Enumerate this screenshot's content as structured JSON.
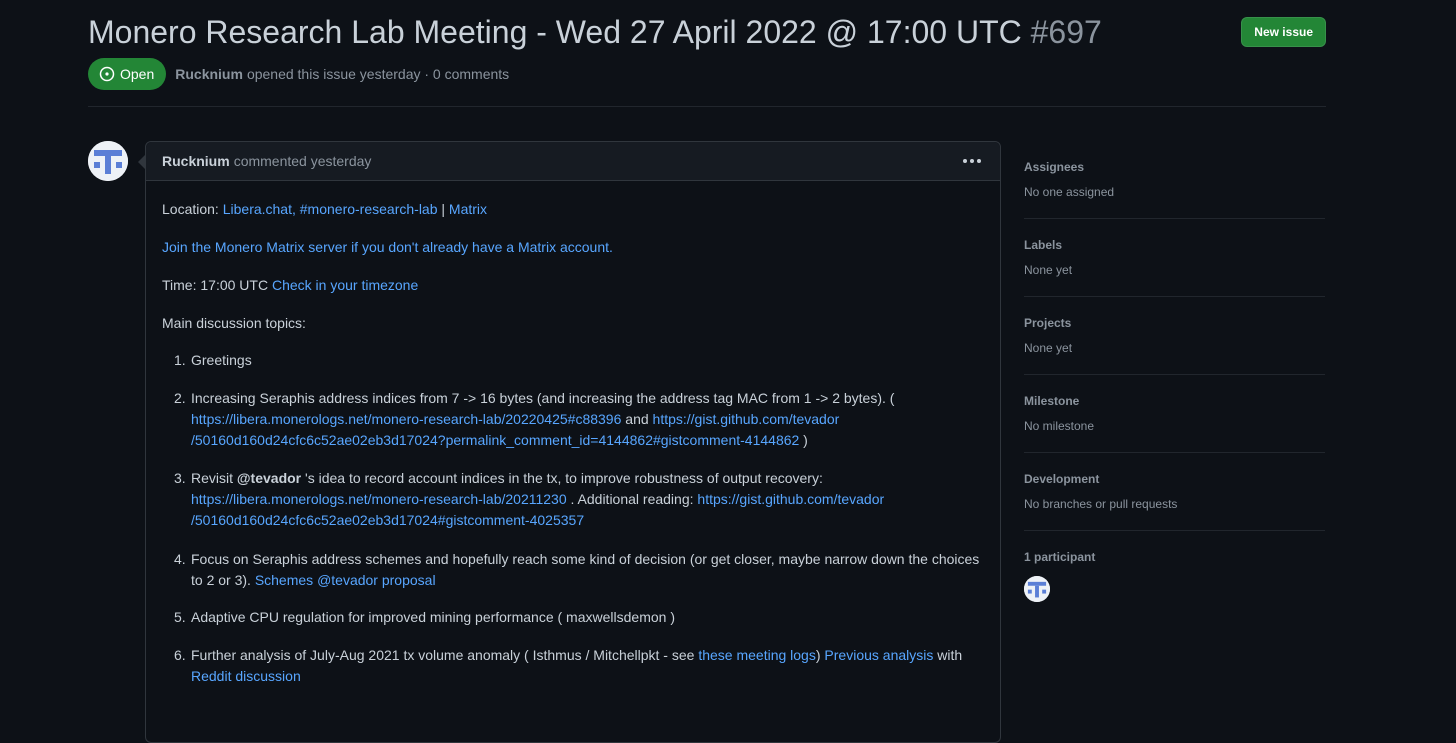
{
  "issue": {
    "title": "Monero Research Lab Meeting - Wed 27 April 2022 @ 17:00 UTC",
    "number": "#697",
    "new_issue_label": "New issue",
    "state": "Open",
    "author": "Rucknium",
    "opened_text": "opened this issue yesterday · 0 comments"
  },
  "comment": {
    "author": "Rucknium",
    "header_text": "commented yesterday",
    "location_label": "Location:",
    "location_link": "Libera.chat, #monero-research-lab",
    "location_sep": "|",
    "matrix_link": "Matrix",
    "join_link": "Join the Monero Matrix server if you don't already have a Matrix account.",
    "time_label": "Time: 17:00 UTC",
    "timezone_link": "Check in your timezone",
    "topics_label": "Main discussion topics:",
    "items": {
      "i1": {
        "num": "1.",
        "text": "Greetings"
      },
      "i2": {
        "num": "2.",
        "text_a": "Increasing Seraphis address indices from 7 -> 16 bytes (and increasing the address tag MAC from 1 -> 2 bytes). (",
        "link_a": "https://libera.monerologs.net/monero-research-lab/20220425#c88396",
        "and": " and ",
        "link_b1": "https://gist.github.com/tevador",
        "link_b2": "/50160d160d24cfc6c52ae02eb3d17024?permalink_comment_id=4144862#gistcomment-4144862",
        "close": " )"
      },
      "i3": {
        "num": "3.",
        "text_a": "Revisit ",
        "mention": "@tevador",
        "text_b": " 's idea to record account indices in the tx, to improve robustness of output recovery:",
        "link_a": "https://libera.monerologs.net/monero-research-lab/20211230",
        "text_c": " . Additional reading: ",
        "link_b1": "https://gist.github.com/tevador",
        "link_b2": "/50160d160d24cfc6c52ae02eb3d17024#gistcomment-4025357"
      },
      "i4": {
        "num": "4.",
        "text_a": "Focus on Seraphis address schemes and hopefully reach some kind of decision (or get closer, maybe narrow down the choices",
        "text_b": "to 2 or 3). ",
        "link_a": "Schemes",
        "link_b": "@tevador proposal"
      },
      "i5": {
        "num": "5.",
        "text": "Adaptive CPU regulation for improved mining performance ( maxwellsdemon )"
      },
      "i6": {
        "num": "6.",
        "text_a": "Further analysis of July-Aug 2021 tx volume anomaly ( Isthmus / Mitchellpkt - see ",
        "link_a": "these meeting logs",
        "text_b": ") ",
        "link_b": "Previous analysis",
        "text_c": " with",
        "link_c": "Reddit discussion"
      }
    }
  },
  "sidebar": {
    "assignees": {
      "title": "Assignees",
      "value": "No one assigned"
    },
    "labels": {
      "title": "Labels",
      "value": "None yet"
    },
    "projects": {
      "title": "Projects",
      "value": "None yet"
    },
    "milestone": {
      "title": "Milestone",
      "value": "No milestone"
    },
    "development": {
      "title": "Development",
      "value": "No branches or pull requests"
    },
    "participants": {
      "title": "1 participant"
    }
  },
  "colors": {
    "accent_link": "#58a6ff",
    "open_green": "#238636",
    "background": "#0d1117"
  },
  "icons": [
    "issue-opened-icon",
    "kebab-horizontal-icon",
    "avatar-identicon"
  ]
}
